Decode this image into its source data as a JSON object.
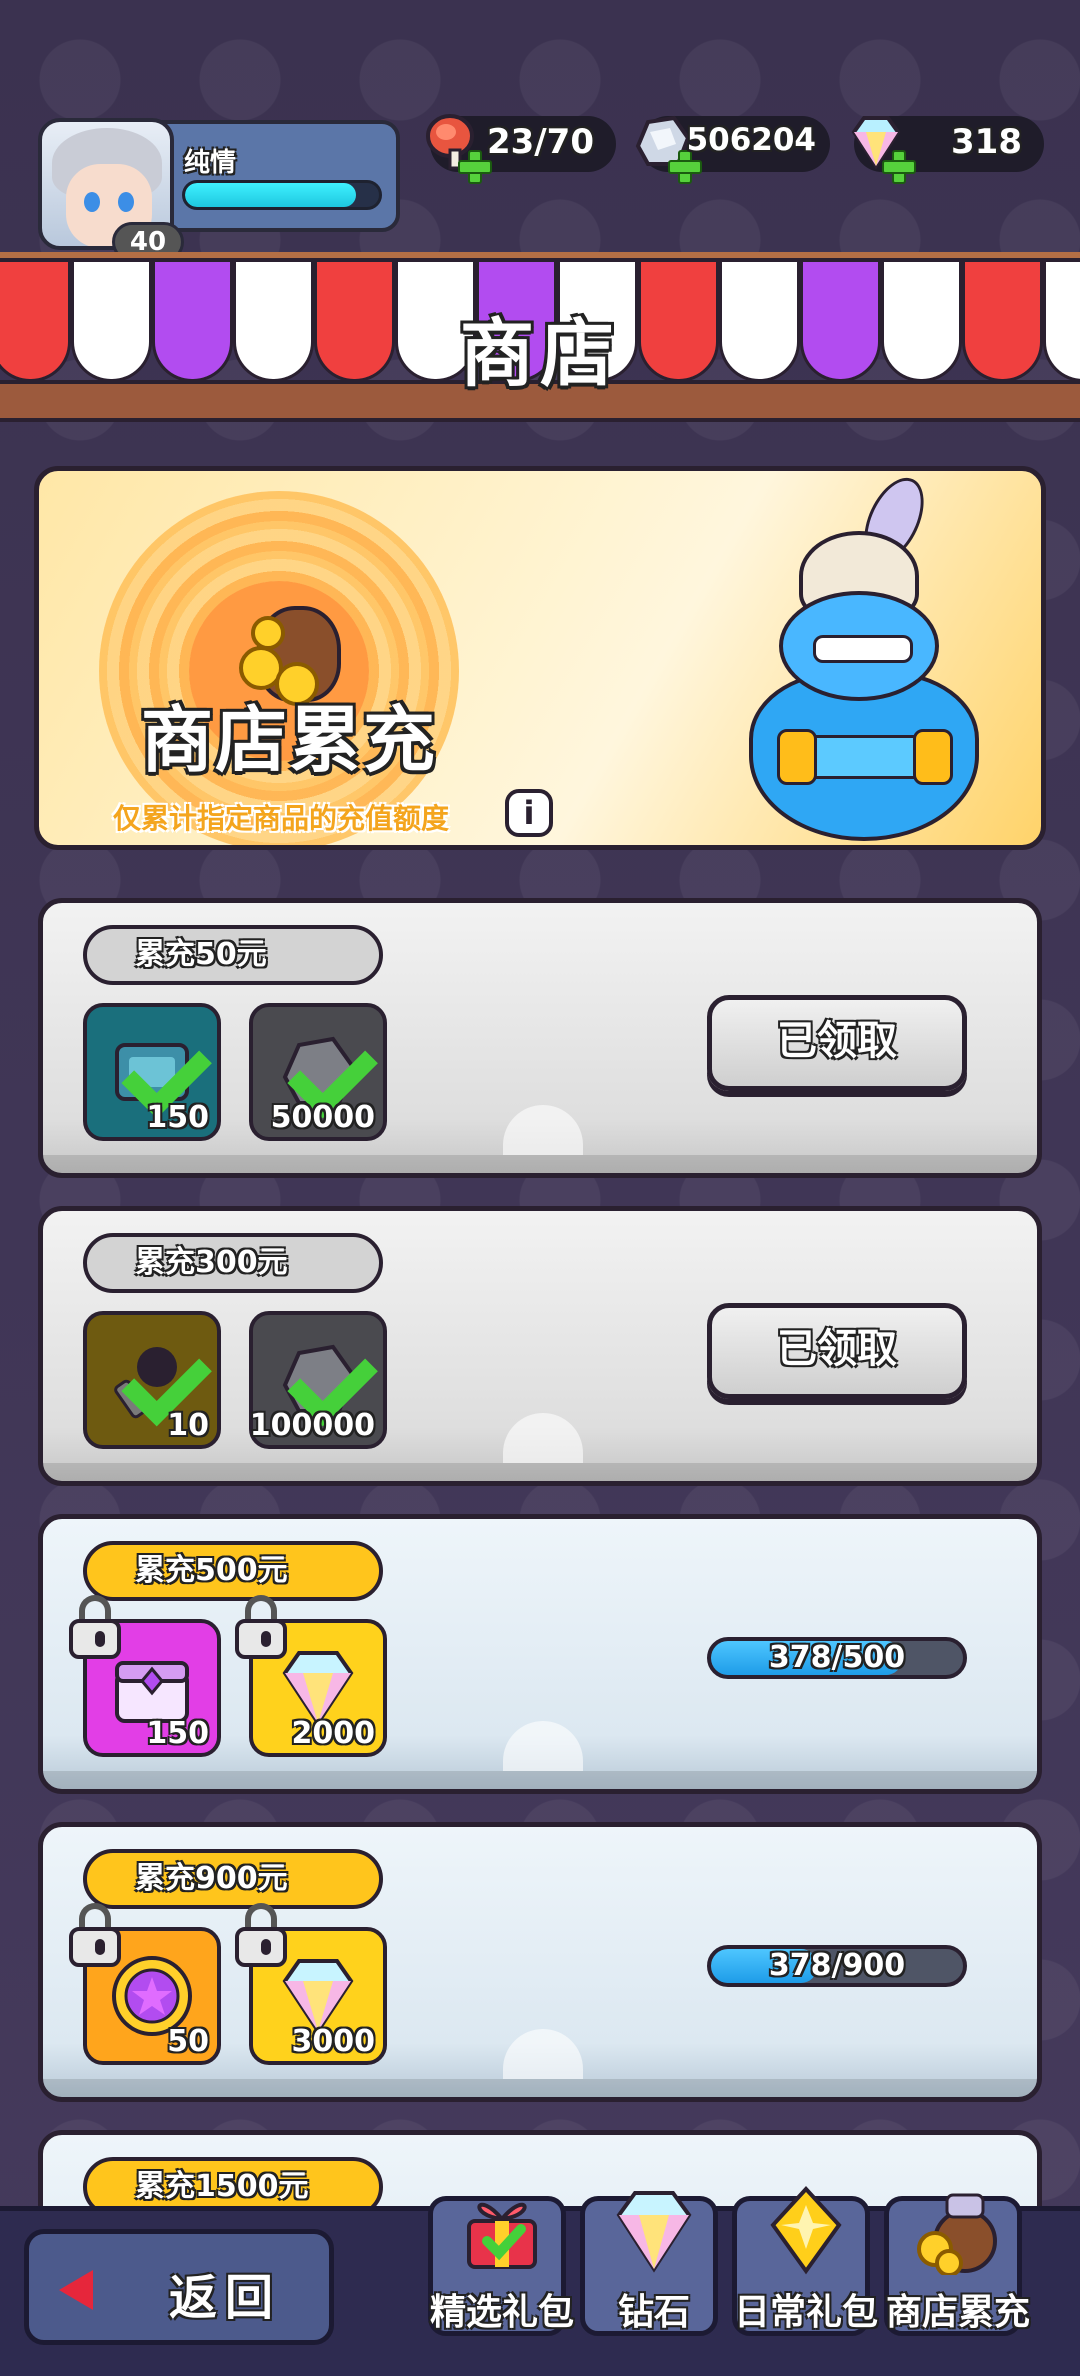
{
  "header": {
    "player": {
      "name": "纯情",
      "level": "40",
      "exp_fraction": 0.88
    },
    "resources": [
      {
        "icon": "meat-icon",
        "value": "23/70"
      },
      {
        "icon": "silver-ore-icon",
        "value": "506204"
      },
      {
        "icon": "diamond-icon",
        "value": "318"
      }
    ]
  },
  "shop": {
    "title": "商店"
  },
  "banner": {
    "title": "商店累充",
    "note": "仅累计指定商品的充值额度",
    "info_label": "i"
  },
  "tiers": [
    {
      "label_prefix": "累充",
      "label_amount": "50元",
      "status": "claimed",
      "button": "已领取",
      "items": [
        {
          "icon": "scroll-ticket-icon",
          "count": "150",
          "claimed": true
        },
        {
          "icon": "silver-ore-icon",
          "count": "50000",
          "claimed": true
        }
      ]
    },
    {
      "label_prefix": "累充",
      "label_amount": "300元",
      "status": "claimed",
      "button": "已领取",
      "items": [
        {
          "icon": "magic-wand-icon",
          "count": "10",
          "claimed": true
        },
        {
          "icon": "silver-ore-icon",
          "count": "100000",
          "claimed": true
        }
      ]
    },
    {
      "label_prefix": "累充",
      "label_amount": "500元",
      "status": "locked",
      "progress": "378/500",
      "progress_value": 378,
      "progress_max": 500,
      "items": [
        {
          "icon": "purple-chest-icon",
          "count": "150",
          "locked": true
        },
        {
          "icon": "diamond-icon",
          "count": "2000",
          "locked": true
        }
      ]
    },
    {
      "label_prefix": "累充",
      "label_amount": "900元",
      "status": "locked",
      "progress": "378/900",
      "progress_value": 378,
      "progress_max": 900,
      "items": [
        {
          "icon": "star-medal-icon",
          "count": "50",
          "locked": true
        },
        {
          "icon": "diamond-icon",
          "count": "3000",
          "locked": true
        }
      ]
    },
    {
      "label_prefix": "累充",
      "label_amount": "1500元",
      "status": "locked"
    }
  ],
  "bottom": {
    "back": "返回",
    "tabs": [
      {
        "icon": "gift-box-icon",
        "label": "精选礼包"
      },
      {
        "icon": "diamond-icon",
        "label": "钻石"
      },
      {
        "icon": "gold-gem-icon",
        "label": "日常礼包"
      },
      {
        "icon": "coin-bag-icon",
        "label": "商店累充"
      }
    ]
  },
  "colors": {
    "background": "#3d3452",
    "awning_red": "#f0403f",
    "awning_white": "#ffffff",
    "awning_purple": "#b24cf0",
    "tier_gold": "#ffc51c",
    "progress_blue": "#1e9ce8",
    "check_green": "#45d03a"
  }
}
